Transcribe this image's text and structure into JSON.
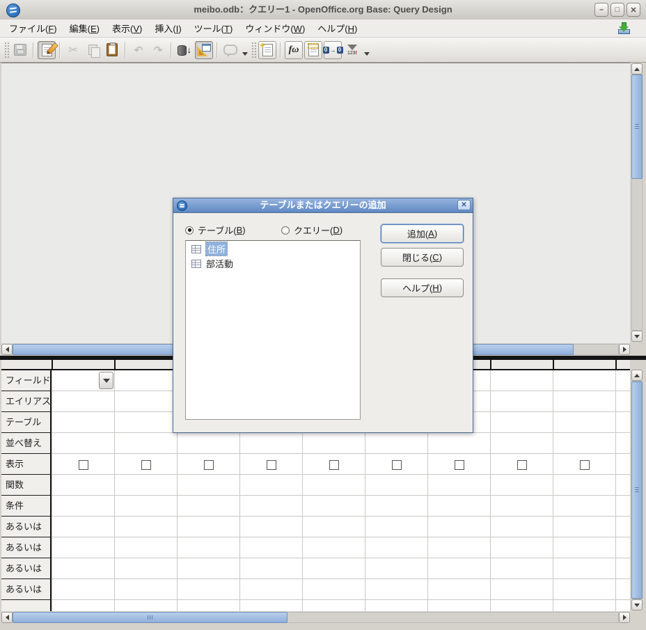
{
  "window": {
    "title": "meibo.odb：クエリー1  -  OpenOffice.org Base: Query Design",
    "buttons": {
      "minimize": "–",
      "maximize": "□",
      "close": "✕"
    }
  },
  "menubar": {
    "items": [
      {
        "pre": "ファイル(",
        "key": "F",
        "post": ")"
      },
      {
        "pre": "編集(",
        "key": "E",
        "post": ")"
      },
      {
        "pre": "表示(",
        "key": "V",
        "post": ")"
      },
      {
        "pre": "挿入(",
        "key": "I",
        "post": ")"
      },
      {
        "pre": "ツール(",
        "key": "T",
        "post": ")"
      },
      {
        "pre": "ウィンドウ(",
        "key": "W",
        "post": ")"
      },
      {
        "pre": "ヘルプ(",
        "key": "H",
        "post": ")"
      }
    ]
  },
  "toolbar": {
    "icons": [
      "save",
      "edit",
      "cut",
      "copy",
      "paste",
      "undo",
      "redo",
      "run-query",
      "design-view-on-off",
      "callout",
      "add-table-or-query",
      "functions",
      "table-name",
      "alias",
      "distinct-values"
    ],
    "functions_glyph": "fω",
    "alias_left": "0",
    "alias_right": "0",
    "alias_arrow": "→",
    "distinct_numbers": "123",
    "distinct_bang": "!"
  },
  "dialog": {
    "title": "テーブルまたはクエリーの追加",
    "close_glyph": "✕",
    "radio_table": {
      "pre": "テーブル(",
      "key": "B",
      "post": ")",
      "selected": true
    },
    "radio_query": {
      "pre": "クエリー(",
      "key": "D",
      "post": ")",
      "selected": false
    },
    "list": [
      {
        "label": "住所",
        "selected": true
      },
      {
        "label": "部活動",
        "selected": false
      }
    ],
    "buttons": {
      "add": {
        "pre": "追加(",
        "key": "A",
        "post": ")",
        "default": true
      },
      "close": {
        "pre": "閉じる(",
        "key": "C",
        "post": ")"
      },
      "help": {
        "pre": "ヘルプ(",
        "key": "H",
        "post": ")"
      }
    }
  },
  "grid": {
    "row_labels": [
      "フィールド",
      "エイリアス",
      "テーブル",
      "並べ替え",
      "表示",
      "関数",
      "条件",
      "あるいは",
      "あるいは",
      "あるいは",
      "あるいは"
    ],
    "visible_columns": 9,
    "checkboxes_checked": false
  },
  "colors": {
    "selection_blue": "#8fb2de",
    "dialog_title_top": "#97b4dd",
    "dialog_title_bottom": "#6089c4",
    "scroll_thumb": "#a9c4e6",
    "splitter_black": "#141414"
  }
}
